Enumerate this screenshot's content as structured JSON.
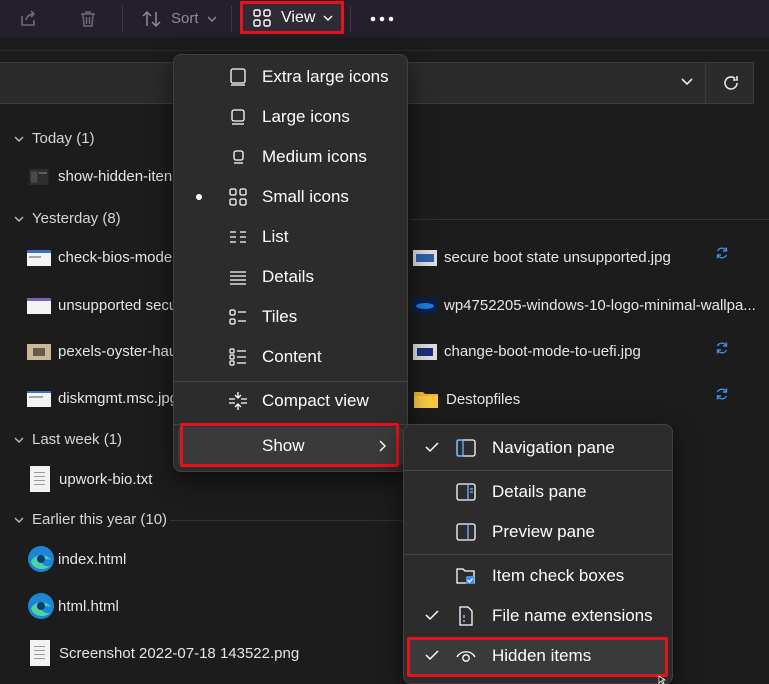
{
  "toolbar": {
    "sort_label": "Sort",
    "view_label": "View",
    "icons": [
      "share-icon",
      "delete-icon",
      "sort-icon",
      "view-grid-icon",
      "chevron-down-icon",
      "more-icon"
    ]
  },
  "file_list": {
    "groups": [
      {
        "label": "Today (1)"
      },
      {
        "label": "Yesterday (8)"
      },
      {
        "label": "Last week (1)"
      },
      {
        "label": "Earlier this year (10)"
      }
    ],
    "files": {
      "show_hidden": "show-hidden-iten",
      "check_bios": "check-bios-mode",
      "unsupported": "unsupported secu",
      "pexels": "pexels-oyster-hau",
      "diskmgmt": "diskmgmt.msc.jpg",
      "secure_boot": "secure boot state unsupported.jpg",
      "wp": "wp4752205-windows-10-logo-minimal-wallpa...",
      "change_boot": "change-boot-mode-to-uefi.jpg",
      "destop": "Destopfiles",
      "upwork": "upwork-bio.txt",
      "index": "index.html",
      "html": "html.html",
      "screenshot": "Screenshot 2022-07-18 143522.png"
    }
  },
  "view_menu": {
    "items": [
      {
        "label": "Extra large icons",
        "icon": "extra-large-icons-icon"
      },
      {
        "label": "Large icons",
        "icon": "large-icons-icon"
      },
      {
        "label": "Medium icons",
        "icon": "medium-icons-icon"
      },
      {
        "label": "Small icons",
        "icon": "small-icons-icon",
        "selected": true
      },
      {
        "label": "List",
        "icon": "list-icon"
      },
      {
        "label": "Details",
        "icon": "details-icon"
      },
      {
        "label": "Tiles",
        "icon": "tiles-icon"
      },
      {
        "label": "Content",
        "icon": "content-icon"
      },
      {
        "label": "Compact view",
        "icon": "compact-view-icon"
      },
      {
        "label": "Show",
        "icon": "chevron-right-icon"
      }
    ]
  },
  "show_menu": {
    "items": [
      {
        "label": "Navigation pane",
        "checked": true,
        "icon": "navigation-pane-icon"
      },
      {
        "label": "Details pane",
        "checked": false,
        "icon": "details-pane-icon"
      },
      {
        "label": "Preview pane",
        "checked": false,
        "icon": "preview-pane-icon"
      },
      {
        "label": "Item check boxes",
        "checked": false,
        "icon": "item-check-boxes-icon"
      },
      {
        "label": "File name extensions",
        "checked": true,
        "icon": "file-extensions-icon"
      },
      {
        "label": "Hidden items",
        "checked": true,
        "icon": "hidden-items-eye-icon"
      }
    ]
  },
  "colors": {
    "background": "#1c1c1c",
    "menu": "#2c2c2c",
    "highlight_box": "#e3141b",
    "accent": "#1e90ff",
    "toolbar": "#241f2a"
  }
}
